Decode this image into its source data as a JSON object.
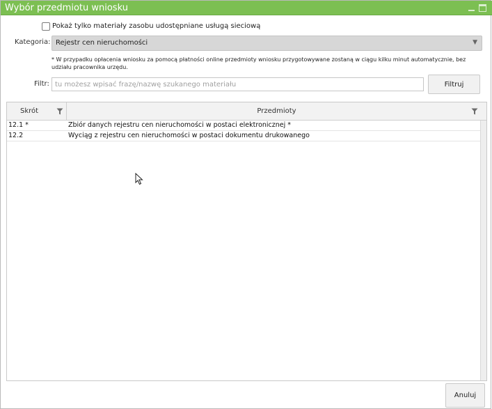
{
  "window": {
    "title": "Wybór przedmiotu wniosku"
  },
  "options": {
    "shared_only_label": "Pokaż tylko materiały zasobu udostępniane usługą sieciową",
    "shared_only_checked": false
  },
  "category": {
    "label": "Kategoria:",
    "selected": "Rejestr cen nieruchomości"
  },
  "note": "* W przypadku opłacenia wniosku za pomocą płatności online przedmioty wniosku przygotowywane zostaną w ciągu kilku minut automatycznie, bez udziału pracownika urzędu.",
  "filter": {
    "label": "Filtr:",
    "value": "",
    "placeholder": "tu możesz wpisać frazę/nazwę szukanego materiału",
    "button_label": "Filtruj"
  },
  "table": {
    "columns": [
      "Skrót",
      "Przedmioty"
    ],
    "rows": [
      {
        "skrot": "12.1 *",
        "przedmiot": "Zbiór danych rejestru cen nieruchomości w postaci elektronicznej *"
      },
      {
        "skrot": "12.2",
        "przedmiot": "Wyciąg z rejestru cen nieruchomości w postaci dokumentu drukowanego"
      }
    ]
  },
  "footer": {
    "cancel_label": "Anuluj"
  },
  "icons": {
    "column_filter": "filter-icon",
    "dropdown": "chevron-down-icon"
  },
  "colors": {
    "titlebar": "#7cbf52",
    "select_bg": "#d7d7d7"
  }
}
